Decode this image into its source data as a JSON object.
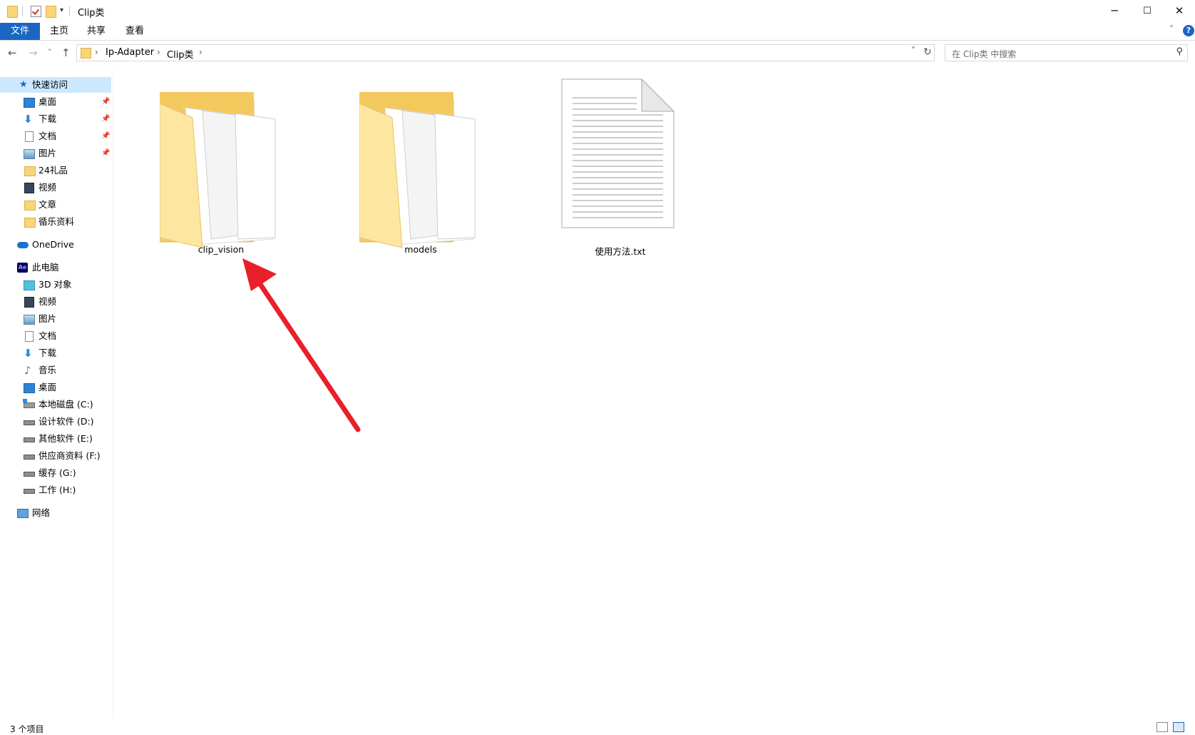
{
  "window": {
    "title": "Clip类",
    "controls": {
      "minimize": "─",
      "maximize": "☐",
      "close": "✕"
    }
  },
  "ribbon": {
    "tabs": [
      {
        "label": "文件"
      },
      {
        "label": "主页"
      },
      {
        "label": "共享"
      },
      {
        "label": "查看"
      }
    ],
    "expand_icon": "chevron-down",
    "help_label": "?"
  },
  "address_bar": {
    "breadcrumbs": [
      "Ip-Adapter",
      "Clip类"
    ],
    "back": "←",
    "forward": "→",
    "recent": "˅",
    "up": "↑",
    "dropdown": "˅",
    "refresh": "↻"
  },
  "search": {
    "placeholder": "在 Clip类 中搜索"
  },
  "nav_pane": {
    "quick_access": {
      "label": "快速访问",
      "items": [
        {
          "label": "桌面",
          "icon": "desktop-icon",
          "pinned": true
        },
        {
          "label": "下载",
          "icon": "download-icon",
          "pinned": true
        },
        {
          "label": "文档",
          "icon": "document-icon",
          "pinned": true
        },
        {
          "label": "图片",
          "icon": "pictures-icon",
          "pinned": true
        },
        {
          "label": "24礼品",
          "icon": "folder-icon",
          "pinned": false
        },
        {
          "label": "视频",
          "icon": "video-icon",
          "pinned": false
        },
        {
          "label": "文章",
          "icon": "folder-icon",
          "pinned": false
        },
        {
          "label": "循乐资料",
          "icon": "folder-icon",
          "pinned": false
        }
      ]
    },
    "onedrive": {
      "label": "OneDrive"
    },
    "this_pc": {
      "label": "此电脑",
      "items": [
        {
          "label": "3D 对象",
          "icon": "3d-objects-icon"
        },
        {
          "label": "视频",
          "icon": "video-icon"
        },
        {
          "label": "图片",
          "icon": "pictures-icon"
        },
        {
          "label": "文档",
          "icon": "document-icon"
        },
        {
          "label": "下载",
          "icon": "download-icon"
        },
        {
          "label": "音乐",
          "icon": "music-icon"
        },
        {
          "label": "桌面",
          "icon": "desktop-icon"
        },
        {
          "label": "本地磁盘 (C:)",
          "icon": "windows-drive-icon"
        },
        {
          "label": "设计软件 (D:)",
          "icon": "drive-icon"
        },
        {
          "label": "其他软件 (E:)",
          "icon": "drive-icon"
        },
        {
          "label": "供应商资料 (F:)",
          "icon": "drive-icon"
        },
        {
          "label": "缓存 (G:)",
          "icon": "drive-icon"
        },
        {
          "label": "工作 (H:)",
          "icon": "drive-icon"
        }
      ]
    },
    "network": {
      "label": "网络"
    }
  },
  "files": [
    {
      "name": "clip_vision",
      "type": "folder"
    },
    {
      "name": "models",
      "type": "folder"
    },
    {
      "name": "使用方法.txt",
      "type": "text-file"
    }
  ],
  "status_bar": {
    "item_count": "3 个项目"
  },
  "colors": {
    "accent": "#1a66c2",
    "selection": "#cce8ff",
    "folder": "#f8d675",
    "annotation_arrow": "#e8202a"
  }
}
